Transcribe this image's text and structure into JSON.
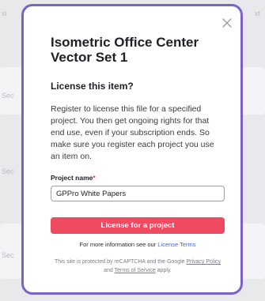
{
  "background": {
    "labels": [
      "xi",
      "Sec",
      "Sec",
      "Sec",
      "xt"
    ]
  },
  "modal": {
    "title": "Isometric Office Center Vector Set 1",
    "subtitle": "License this item?",
    "description": "Register to license this file for a specified project. You then get ongoing rights for that end use, even if your subscription ends. So make sure you register each project you use an item on.",
    "field_label": "Project name",
    "field_required_mark": "*",
    "field_value": "GPPro White Papers",
    "cta_label": "License for a project",
    "more_info_prefix": "For more information see our",
    "more_info_link": "License Terms",
    "recaptcha_prefix": "This site is protected by reCAPTCHA and the Google",
    "privacy_link": "Privacy Policy",
    "recaptcha_and": "and",
    "tos_link": "Terms of Service",
    "recaptcha_suffix": "apply."
  },
  "colors": {
    "accent_border": "#7b61c8",
    "cta": "#f04a61",
    "link": "#3f6bd6",
    "required": "#e23c55"
  },
  "icons": {
    "close": "close-icon"
  }
}
